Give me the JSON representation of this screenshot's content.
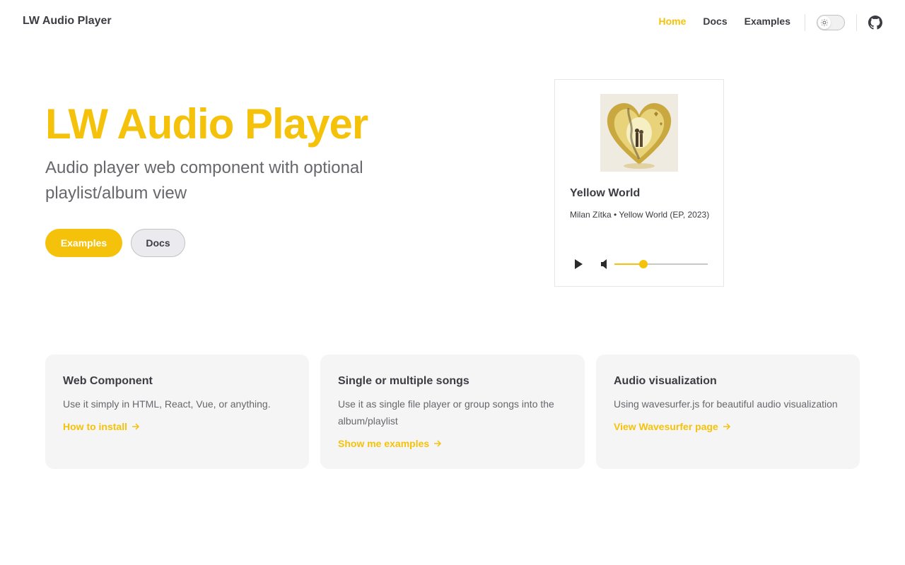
{
  "nav": {
    "brand": "LW Audio Player",
    "links": [
      {
        "label": "Home",
        "active": true
      },
      {
        "label": "Docs",
        "active": false
      },
      {
        "label": "Examples",
        "active": false
      }
    ]
  },
  "hero": {
    "title": "LW Audio Player",
    "tagline": "Audio player web component with optional playlist/album view",
    "primary_button": "Examples",
    "secondary_button": "Docs"
  },
  "player": {
    "song_title": "Yellow World",
    "meta": "Milan Zítka • Yellow World (EP, 2023)",
    "volume_level": 0.31
  },
  "features": [
    {
      "title": "Web Component",
      "text": "Use it simply in HTML, React, Vue, or anything.",
      "link": "How to install"
    },
    {
      "title": "Single or multiple songs",
      "text": "Use it as single file player or group songs into the album/playlist",
      "link": "Show me examples"
    },
    {
      "title": "Audio visualization",
      "text": "Using wavesurfer.js for beautiful audio visualization",
      "link": "View Wavesurfer page"
    }
  ],
  "colors": {
    "accent": "#f5c20b",
    "text": "#3c3c43",
    "muted": "#67676c",
    "card_bg": "#f5f5f5"
  }
}
